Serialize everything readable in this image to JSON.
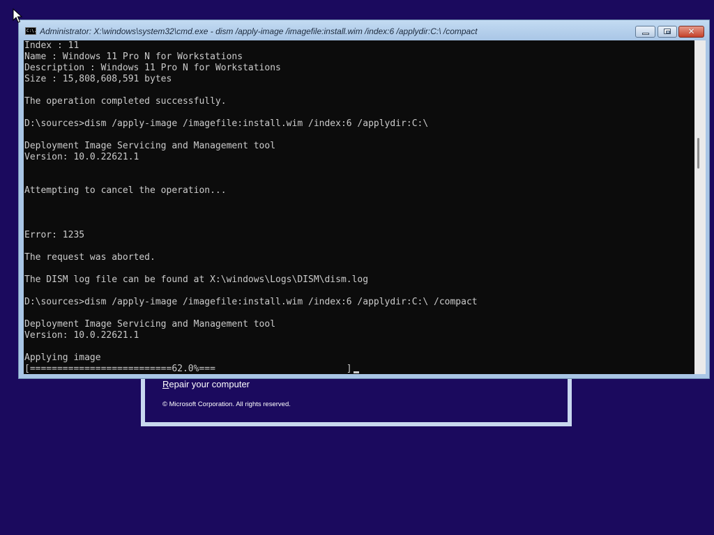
{
  "window": {
    "title": "Administrator: X:\\windows\\system32\\cmd.exe - dism  /apply-image /imagefile:install.wim /index:6 /applydir:C:\\ /compact",
    "icon": "cmd-icon",
    "icon_label": "C:\\."
  },
  "console": {
    "lines": [
      "Index : 11",
      "Name : Windows 11 Pro N for Workstations",
      "Description : Windows 11 Pro N for Workstations",
      "Size : 15,808,608,591 bytes",
      "",
      "The operation completed successfully.",
      "",
      "D:\\sources>dism /apply-image /imagefile:install.wim /index:6 /applydir:C:\\",
      "",
      "Deployment Image Servicing and Management tool",
      "Version: 10.0.22621.1",
      "",
      "",
      "Attempting to cancel the operation...",
      "",
      "",
      "",
      "Error: 1235",
      "",
      "The request was aborted.",
      "",
      "The DISM log file can be found at X:\\windows\\Logs\\DISM\\dism.log",
      "",
      "D:\\sources>dism /apply-image /imagefile:install.wim /index:6 /applydir:C:\\ /compact",
      "",
      "Deployment Image Servicing and Management tool",
      "Version: 10.0.22621.1",
      "",
      "Applying image"
    ],
    "progress_line": "[==========================62.0%===                        ]",
    "progress_percent": 62.0
  },
  "setup": {
    "repair_link_first": "R",
    "repair_link_rest": "epair your computer",
    "copyright": "© Microsoft Corporation. All rights reserved."
  },
  "colors": {
    "desktop_background": "#1b0a5e",
    "console_background": "#0c0c0c",
    "console_text": "#cccccc",
    "window_frame": "#a9c6e6",
    "close_button": "#c4412a"
  }
}
